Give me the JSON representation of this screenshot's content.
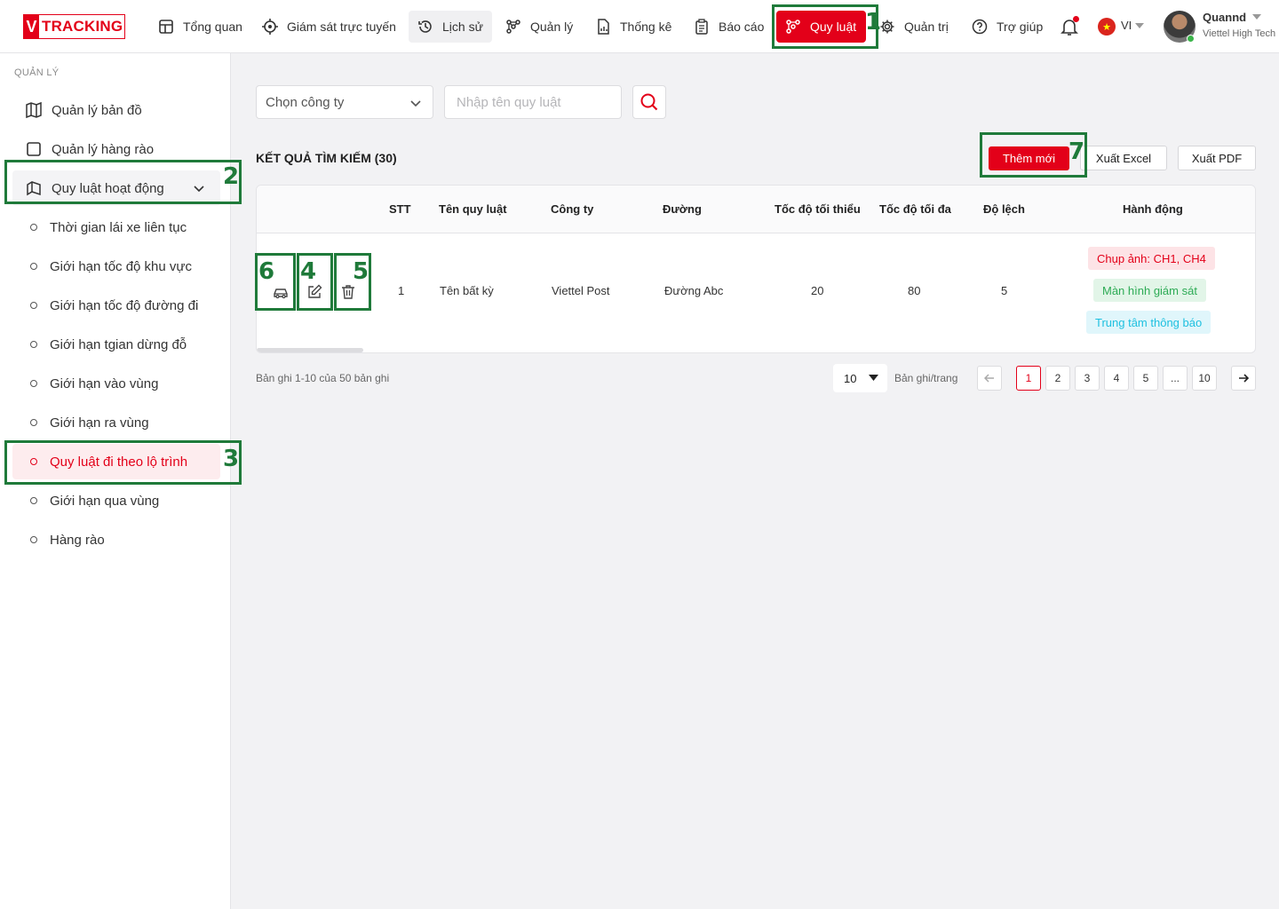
{
  "brand": {
    "letter": "V",
    "name": "TRACKING"
  },
  "nav": [
    {
      "label": "Tổng quan",
      "icon": "dashboard-icon"
    },
    {
      "label": "Giám sát trực tuyến",
      "icon": "crosshair-icon"
    },
    {
      "label": "Lịch sử",
      "icon": "history-icon"
    },
    {
      "label": "Quản lý",
      "icon": "network-icon"
    },
    {
      "label": "Thống kê",
      "icon": "report-chart-icon"
    },
    {
      "label": "Báo cáo",
      "icon": "clipboard-icon"
    },
    {
      "label": "Quy luật",
      "icon": "rules-icon"
    },
    {
      "label": "Quản trị",
      "icon": "gear-icon"
    },
    {
      "label": "Trợ giúp",
      "icon": "help-icon"
    }
  ],
  "header": {
    "lang": "VI",
    "user_name": "Quannd",
    "user_company": "Viettel High Tech"
  },
  "sidebar": {
    "heading": "QUẢN LÝ",
    "items": [
      {
        "label": "Quản lý bản đồ"
      },
      {
        "label": "Quản lý hàng rào"
      },
      {
        "label": "Quy luật hoạt động"
      }
    ],
    "subitems": [
      {
        "label": "Thời gian lái xe liên tục"
      },
      {
        "label": "Giới hạn tốc độ khu vực"
      },
      {
        "label": "Giới hạn tốc độ đường đi"
      },
      {
        "label": "Giới hạn tgian dừng đỗ"
      },
      {
        "label": "Giới hạn vào vùng"
      },
      {
        "label": "Giới hạn ra vùng"
      },
      {
        "label": "Quy luật đi theo lộ trình"
      },
      {
        "label": "Giới hạn qua vùng"
      },
      {
        "label": "Hàng rào"
      }
    ]
  },
  "filters": {
    "company_placeholder": "Chọn công ty",
    "rule_placeholder": "Nhập tên quy luật"
  },
  "results": {
    "title": "KẾT QUẢ TÌM KIẾM (30)",
    "add_label": "Thêm mới",
    "excel_label": "Xuất Excel",
    "pdf_label": "Xuất PDF"
  },
  "table": {
    "columns": [
      "STT",
      "Tên quy luật",
      "Công ty",
      "Đường",
      "Tốc độ tối thiểu",
      "Tốc độ tối đa",
      "Độ lệch",
      "Hành động"
    ],
    "rows": [
      {
        "stt": "1",
        "name": "Tên bất kỳ",
        "company": "Viettel Post",
        "road": "Đường Abc",
        "min_speed": "20",
        "max_speed": "80",
        "deviation": "5",
        "tags": [
          "Chụp ảnh: CH1, CH4",
          "Màn hình giám sát",
          "Trung tâm thông báo"
        ]
      }
    ]
  },
  "pagination": {
    "info": "Bản ghi 1-10 của 50 bản ghi",
    "page_size": "10",
    "per_page_label": "Bản ghi/trang",
    "pages": [
      "1",
      "2",
      "3",
      "4",
      "5",
      "...",
      "10"
    ],
    "current": "1"
  },
  "annotations": [
    "1",
    "2",
    "3",
    "4",
    "5",
    "6",
    "7"
  ],
  "colors": {
    "accent": "#e30019",
    "annotation": "#1f7a3a"
  }
}
